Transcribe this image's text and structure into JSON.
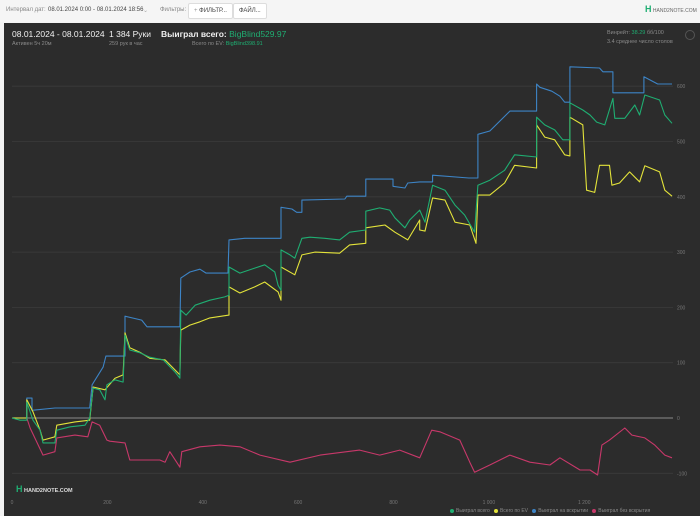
{
  "toolbar": {
    "interval_label": "Интервал дат:",
    "interval_value": "08.01.2024 0:00 - 08.01.2024 18:56",
    "filters_label": "Фильтры:",
    "filter_button": "ФИЛЬТР...",
    "file_button": "ФАЙЛ...",
    "logo": "HAND2NOTE.COM"
  },
  "summary": {
    "date_range": "08.01.2024 - 08.01.2024",
    "active": "Активен 5ч 20м",
    "hands": "1 384 Руки",
    "hands_per_hour": "259 рук в час",
    "won_total_label": "Выиграл всего:",
    "won_total_value": "BigBlind529.97",
    "ev_label": "Всего по EV:",
    "ev_value": "BigBlind398.91",
    "winrate_label": "Винрейт:",
    "winrate_value": "38.29",
    "winrate_unit": "бб/100",
    "tables": "3.4 среднее число столов"
  },
  "watermark": "HAND2NOTE.COM",
  "colors": {
    "green": "#1fae72",
    "yellow": "#e3e33a",
    "blue": "#3d84c6",
    "pink": "#c8386a"
  },
  "chart_data": {
    "type": "line",
    "xlim": [
      0,
      1384
    ],
    "ylim": [
      -150,
      650
    ],
    "x_ticks": [
      0,
      200,
      400,
      600,
      800,
      1000,
      1200
    ],
    "x_tick_labels": [
      "0",
      "200",
      "400",
      "600",
      "800",
      "1 000",
      "1 200"
    ],
    "y_ticks": [
      -100,
      0,
      100,
      200,
      300,
      400,
      500,
      600
    ],
    "y_tick_labels": [
      "-100",
      "0",
      "100",
      "200",
      "300",
      "400",
      "500",
      "600"
    ],
    "legend": "bottom-right",
    "series": [
      {
        "name": "Выиграл всего",
        "color": "#1fae72",
        "points": [
          [
            0,
            0
          ],
          [
            17,
            -4
          ],
          [
            31,
            -4
          ],
          [
            31,
            29
          ],
          [
            44,
            -4
          ],
          [
            59,
            -22
          ],
          [
            65,
            -45
          ],
          [
            90,
            -45
          ],
          [
            94,
            -22
          ],
          [
            122,
            -16
          ],
          [
            153,
            -13
          ],
          [
            163,
            0
          ],
          [
            170,
            54
          ],
          [
            184,
            51
          ],
          [
            195,
            33
          ],
          [
            199,
            60
          ],
          [
            216,
            69
          ],
          [
            233,
            65
          ],
          [
            237,
            150
          ],
          [
            247,
            123
          ],
          [
            268,
            118
          ],
          [
            289,
            110
          ],
          [
            317,
            105
          ],
          [
            342,
            83
          ],
          [
            352,
            72
          ],
          [
            354,
            195
          ],
          [
            365,
            186
          ],
          [
            384,
            204
          ],
          [
            415,
            213
          ],
          [
            446,
            219
          ],
          [
            455,
            222
          ],
          [
            455,
            273
          ],
          [
            478,
            262
          ],
          [
            509,
            271
          ],
          [
            530,
            277
          ],
          [
            551,
            264
          ],
          [
            558,
            240
          ],
          [
            564,
            231
          ],
          [
            564,
            304
          ],
          [
            583,
            295
          ],
          [
            593,
            289
          ],
          [
            608,
            325
          ],
          [
            625,
            327
          ],
          [
            656,
            325
          ],
          [
            687,
            322
          ],
          [
            708,
            336
          ],
          [
            742,
            340
          ],
          [
            742,
            374
          ],
          [
            771,
            380
          ],
          [
            792,
            376
          ],
          [
            803,
            362
          ],
          [
            824,
            344
          ],
          [
            834,
            358
          ],
          [
            855,
            376
          ],
          [
            866,
            354
          ],
          [
            882,
            421
          ],
          [
            908,
            412
          ],
          [
            929,
            385
          ],
          [
            949,
            367
          ],
          [
            970,
            336
          ],
          [
            977,
            421
          ],
          [
            1002,
            430
          ],
          [
            1033,
            448
          ],
          [
            1054,
            476
          ],
          [
            1100,
            472
          ],
          [
            1100,
            544
          ],
          [
            1117,
            530
          ],
          [
            1138,
            521
          ],
          [
            1155,
            503
          ],
          [
            1170,
            503
          ],
          [
            1170,
            570
          ],
          [
            1197,
            557
          ],
          [
            1212,
            548
          ],
          [
            1226,
            535
          ],
          [
            1243,
            530
          ],
          [
            1260,
            578
          ],
          [
            1264,
            542
          ],
          [
            1285,
            542
          ],
          [
            1306,
            566
          ],
          [
            1316,
            548
          ],
          [
            1327,
            584
          ],
          [
            1358,
            575
          ],
          [
            1369,
            548
          ],
          [
            1384,
            533
          ]
        ]
      },
      {
        "name": "Всего по EV",
        "color": "#e3e33a",
        "points": [
          [
            0,
            0
          ],
          [
            31,
            0
          ],
          [
            31,
            33
          ],
          [
            44,
            11
          ],
          [
            59,
            -22
          ],
          [
            65,
            -40
          ],
          [
            90,
            -34
          ],
          [
            94,
            -13
          ],
          [
            132,
            -7
          ],
          [
            163,
            -4
          ],
          [
            170,
            56
          ],
          [
            195,
            51
          ],
          [
            216,
            72
          ],
          [
            233,
            78
          ],
          [
            237,
            154
          ],
          [
            247,
            127
          ],
          [
            268,
            119
          ],
          [
            289,
            108
          ],
          [
            321,
            105
          ],
          [
            352,
            78
          ],
          [
            354,
            159
          ],
          [
            373,
            168
          ],
          [
            394,
            174
          ],
          [
            415,
            181
          ],
          [
            455,
            186
          ],
          [
            455,
            237
          ],
          [
            478,
            226
          ],
          [
            509,
            237
          ],
          [
            530,
            246
          ],
          [
            558,
            228
          ],
          [
            564,
            213
          ],
          [
            564,
            273
          ],
          [
            593,
            259
          ],
          [
            608,
            295
          ],
          [
            635,
            300
          ],
          [
            687,
            298
          ],
          [
            708,
            313
          ],
          [
            742,
            316
          ],
          [
            742,
            344
          ],
          [
            782,
            349
          ],
          [
            803,
            336
          ],
          [
            830,
            322
          ],
          [
            855,
            358
          ],
          [
            855,
            340
          ],
          [
            866,
            338
          ],
          [
            882,
            398
          ],
          [
            908,
            394
          ],
          [
            929,
            354
          ],
          [
            960,
            349
          ],
          [
            973,
            316
          ],
          [
            977,
            403
          ],
          [
            1002,
            403
          ],
          [
            1033,
            425
          ],
          [
            1054,
            457
          ],
          [
            1100,
            452
          ],
          [
            1100,
            530
          ],
          [
            1117,
            508
          ],
          [
            1138,
            503
          ],
          [
            1159,
            476
          ],
          [
            1170,
            474
          ],
          [
            1170,
            544
          ],
          [
            1197,
            530
          ],
          [
            1205,
            412
          ],
          [
            1222,
            408
          ],
          [
            1232,
            457
          ],
          [
            1253,
            457
          ],
          [
            1258,
            421
          ],
          [
            1274,
            425
          ],
          [
            1295,
            445
          ],
          [
            1316,
            427
          ],
          [
            1327,
            456
          ],
          [
            1358,
            445
          ],
          [
            1369,
            412
          ],
          [
            1384,
            401
          ]
        ]
      },
      {
        "name": "Выиграл на вскрытии",
        "color": "#3d84c6",
        "points": [
          [
            0,
            0
          ],
          [
            31,
            0
          ],
          [
            31,
            36
          ],
          [
            42,
            36
          ],
          [
            42,
            14
          ],
          [
            90,
            18
          ],
          [
            163,
            18
          ],
          [
            168,
            60
          ],
          [
            191,
            92
          ],
          [
            197,
            112
          ],
          [
            237,
            112
          ],
          [
            237,
            184
          ],
          [
            272,
            177
          ],
          [
            283,
            165
          ],
          [
            352,
            165
          ],
          [
            354,
            253
          ],
          [
            373,
            264
          ],
          [
            394,
            269
          ],
          [
            407,
            262
          ],
          [
            453,
            262
          ],
          [
            455,
            322
          ],
          [
            488,
            325
          ],
          [
            564,
            325
          ],
          [
            564,
            381
          ],
          [
            587,
            378
          ],
          [
            597,
            372
          ],
          [
            608,
            372
          ],
          [
            608,
            394
          ],
          [
            698,
            396
          ],
          [
            702,
            401
          ],
          [
            742,
            401
          ],
          [
            742,
            432
          ],
          [
            799,
            432
          ],
          [
            799,
            419
          ],
          [
            824,
            416
          ],
          [
            830,
            425
          ],
          [
            855,
            427
          ],
          [
            882,
            427
          ],
          [
            882,
            439
          ],
          [
            958,
            434
          ],
          [
            977,
            434
          ],
          [
            977,
            513
          ],
          [
            1002,
            519
          ],
          [
            1044,
            555
          ],
          [
            1075,
            555
          ],
          [
            1100,
            555
          ],
          [
            1100,
            604
          ],
          [
            1107,
            598
          ],
          [
            1132,
            591
          ],
          [
            1149,
            582
          ],
          [
            1159,
            571
          ],
          [
            1170,
            571
          ],
          [
            1170,
            635
          ],
          [
            1232,
            633
          ],
          [
            1239,
            626
          ],
          [
            1260,
            626
          ],
          [
            1260,
            588
          ],
          [
            1325,
            588
          ],
          [
            1325,
            617
          ],
          [
            1354,
            604
          ],
          [
            1384,
            604
          ]
        ]
      },
      {
        "name": "Выиграл без вскрытия",
        "color": "#c8386a",
        "points": [
          [
            0,
            0
          ],
          [
            31,
            0
          ],
          [
            38,
            -18
          ],
          [
            65,
            -67
          ],
          [
            90,
            -61
          ],
          [
            94,
            -36
          ],
          [
            132,
            -31
          ],
          [
            159,
            -34
          ],
          [
            168,
            -7
          ],
          [
            184,
            -13
          ],
          [
            199,
            -40
          ],
          [
            205,
            -42
          ],
          [
            237,
            -45
          ],
          [
            247,
            -76
          ],
          [
            310,
            -76
          ],
          [
            321,
            -80
          ],
          [
            331,
            -61
          ],
          [
            352,
            -89
          ],
          [
            356,
            -61
          ],
          [
            394,
            -52
          ],
          [
            436,
            -49
          ],
          [
            478,
            -52
          ],
          [
            520,
            -67
          ],
          [
            583,
            -80
          ],
          [
            646,
            -67
          ],
          [
            729,
            -58
          ],
          [
            771,
            -67
          ],
          [
            813,
            -58
          ],
          [
            855,
            -72
          ],
          [
            880,
            -22
          ],
          [
            897,
            -25
          ],
          [
            939,
            -40
          ],
          [
            960,
            -80
          ],
          [
            970,
            -98
          ],
          [
            1002,
            -85
          ],
          [
            1044,
            -67
          ],
          [
            1086,
            -80
          ],
          [
            1128,
            -85
          ],
          [
            1149,
            -72
          ],
          [
            1191,
            -94
          ],
          [
            1212,
            -94
          ],
          [
            1228,
            -103
          ],
          [
            1237,
            -49
          ],
          [
            1253,
            -40
          ],
          [
            1285,
            -18
          ],
          [
            1300,
            -31
          ],
          [
            1327,
            -36
          ],
          [
            1348,
            -49
          ],
          [
            1369,
            -67
          ],
          [
            1384,
            -72
          ]
        ]
      }
    ]
  }
}
